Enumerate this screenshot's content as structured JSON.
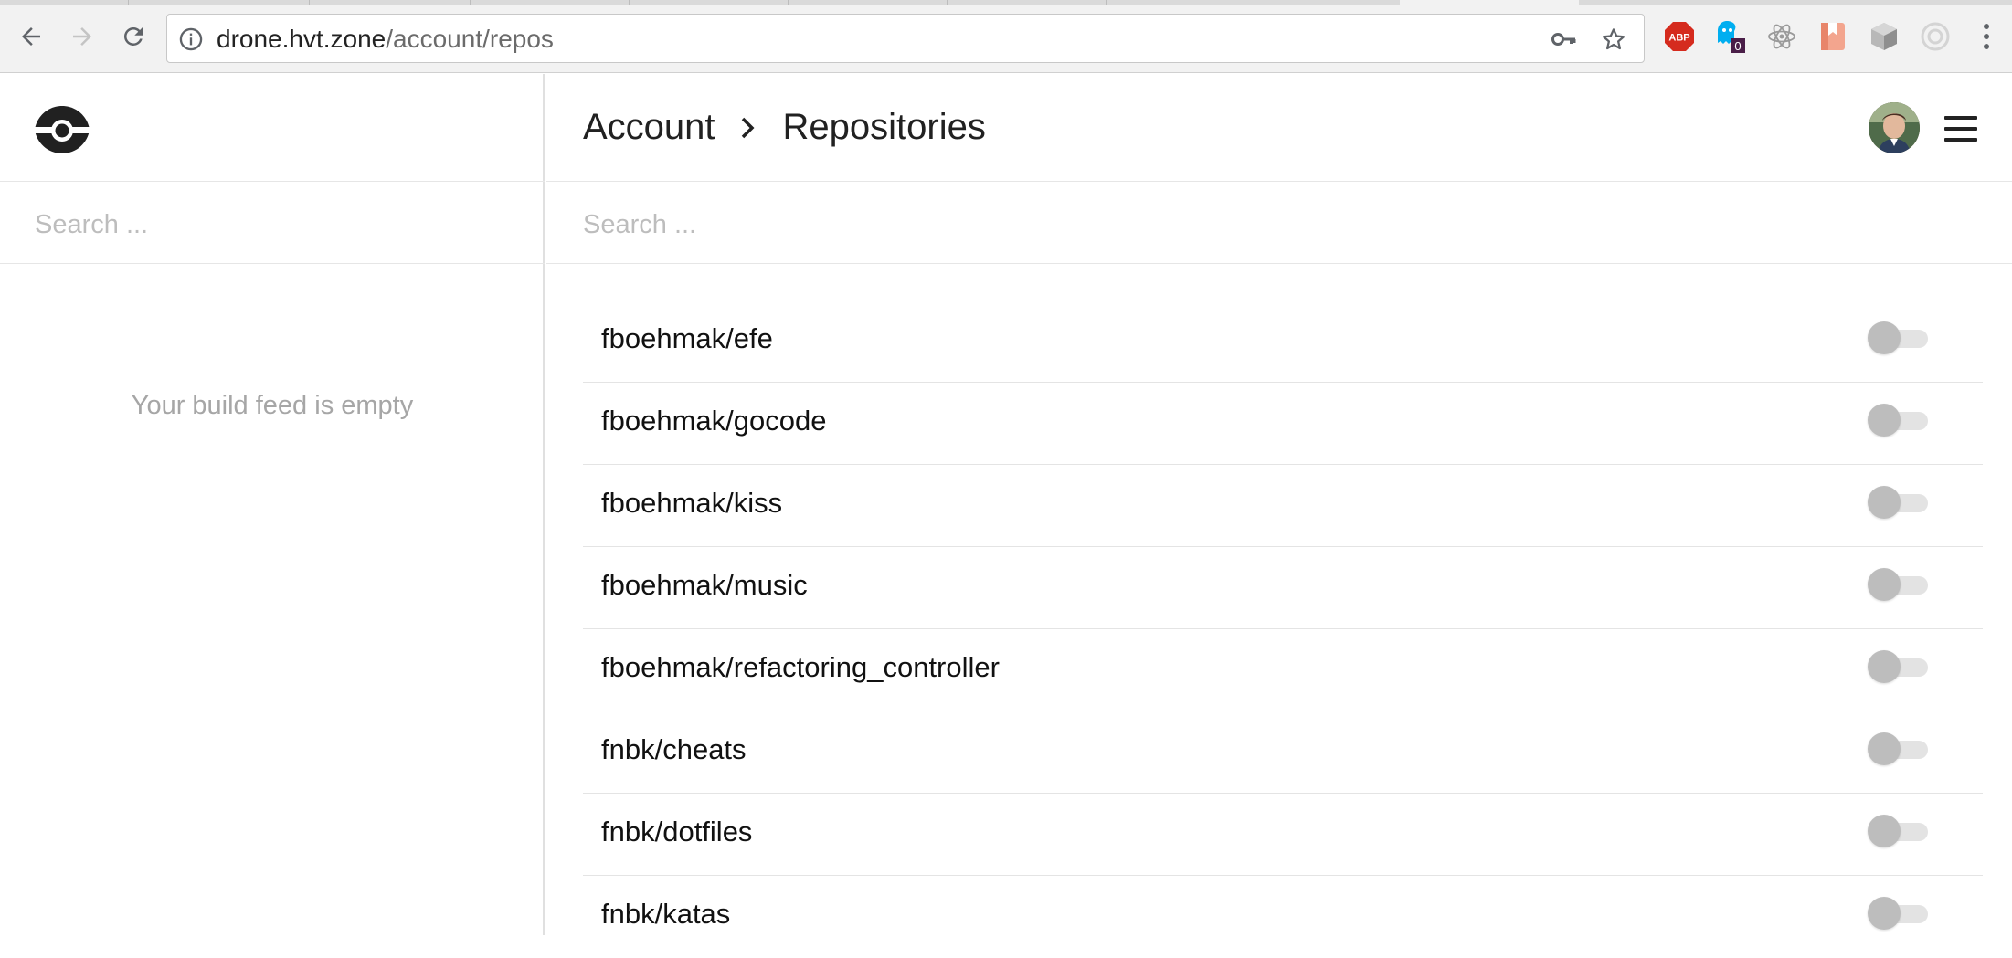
{
  "browser": {
    "url_host": "drone.hvt.zone",
    "url_path": "/account/repos",
    "extensions": [
      {
        "name": "adblock-plus-icon",
        "label": "ABP",
        "color": "#d52b1e"
      },
      {
        "name": "ghostery-icon",
        "badge": "0",
        "color": "#00aef0"
      },
      {
        "name": "react-devtools-icon",
        "color": "#8c8c8c"
      },
      {
        "name": "bitwarden-like-icon",
        "color": "#f0957a"
      },
      {
        "name": "cube-extension-icon",
        "color": "#9a9a9a"
      },
      {
        "name": "target-extension-icon",
        "color": "#cfcfcf"
      }
    ]
  },
  "sidebar": {
    "search_placeholder": "Search ...",
    "empty_message": "Your build feed is empty"
  },
  "main": {
    "breadcrumb": {
      "parent": "Account",
      "current": "Repositories"
    },
    "search_placeholder": "Search ...",
    "repos": [
      {
        "name": "fboehmak/efe",
        "active": false
      },
      {
        "name": "fboehmak/gocode",
        "active": false
      },
      {
        "name": "fboehmak/kiss",
        "active": false
      },
      {
        "name": "fboehmak/music",
        "active": false
      },
      {
        "name": "fboehmak/refactoring_controller",
        "active": false
      },
      {
        "name": "fnbk/cheats",
        "active": false
      },
      {
        "name": "fnbk/dotfiles",
        "active": false
      },
      {
        "name": "fnbk/katas",
        "active": false
      }
    ]
  },
  "colors": {
    "text_primary": "#212121",
    "muted": "#a6a6a6",
    "toggle_off_knob": "#bdbdbd",
    "toggle_off_track": "#e3e3e3"
  }
}
